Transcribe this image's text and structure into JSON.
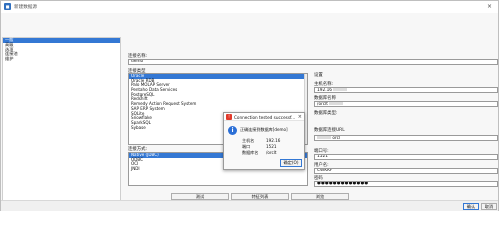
{
  "window": {
    "title": "新建数据源"
  },
  "nav": {
    "items": [
      "一般",
      "高级",
      "选项",
      "连接池",
      "维护"
    ]
  },
  "form": {
    "name_label": "连接名称:",
    "name_value": "demo",
    "type_label": "连接类型",
    "driver_label": "连接方式:",
    "settings_label": "设置",
    "host_label": "主机名称:",
    "host_value": "192.16",
    "dbname_label": "数据库名称",
    "dbname_value": "/orclt",
    "db_type_label": "数据库类型:",
    "url_label": "数据库连接URL",
    "url_value": "orcl",
    "port_label": "端口号:",
    "port_value": "1521",
    "user_label": "用户名:",
    "user_value": "CWKKF",
    "password_label": "密码",
    "password_value": "●●●●●●●●●●●●●"
  },
  "type_list": [
    "Oracle",
    "Oracle RDB",
    "Palo MOLAP Server",
    "Pentaho Data Services",
    "PostgreSQL",
    "Redshift",
    "Remedy Action Request System",
    "SAP ERP System",
    "SQLite",
    "Snowflake",
    "SparkSQL",
    "Sybase"
  ],
  "access_list": [
    "Native (JDBC)",
    "ODBC",
    "OCI",
    "JNDI"
  ],
  "buttons": {
    "test": "测试",
    "feature": "特征列表",
    "browse": "浏览",
    "ok": "确认",
    "cancel": "取消"
  },
  "dialog": {
    "title": "Connection tested successf...",
    "message": "正确连接到数据库[demo]",
    "host_label": "主机名",
    "host_value": "192.16",
    "port_label": "端口",
    "port_value": "1521",
    "db_label": "数据库名",
    "db_value": "/orclt",
    "ok": "确定(O)"
  }
}
